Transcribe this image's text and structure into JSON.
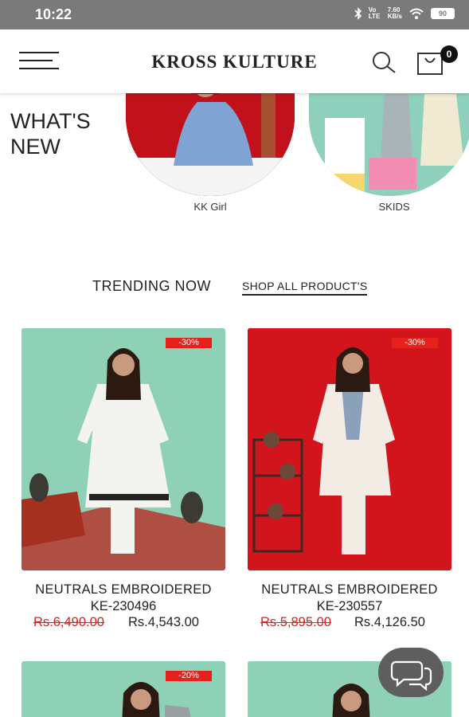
{
  "status_bar": {
    "time": "10:22",
    "network_label": "Vo LTE",
    "speed_value": "7.60",
    "speed_unit": "KB/s",
    "battery": "90"
  },
  "header": {
    "brand": "KROSS KULTURE",
    "cart_count": "0"
  },
  "whats_new": {
    "title": "WHAT'S NEW",
    "categories": [
      {
        "label": "KK Girl",
        "bg": "#c1121c"
      },
      {
        "label": "SKIDS",
        "bg": "#8ed0bb"
      }
    ]
  },
  "trending": {
    "title": "TRENDING NOW",
    "shop_all": "SHOP ALL PRODUCT'S"
  },
  "products": [
    {
      "name": "NEUTRALS EMBROIDERED",
      "code": "KE-230496",
      "old_price": "Rs.6,490.00",
      "new_price": "Rs.4,543.00",
      "discount": "-30%",
      "bg": "#8fd1b6"
    },
    {
      "name": "NEUTRALS EMBROIDERED",
      "code": "KE-230557",
      "old_price": "Rs.5,895.00",
      "new_price": "Rs.4,126.50",
      "discount": "-30%",
      "bg": "#d2141c"
    },
    {
      "discount": "-20%",
      "bg": "#8fd1b6"
    },
    {
      "bg": "#8fd1b6"
    }
  ],
  "colors": {
    "accent_red": "#e8201c",
    "price_red": "#e21b1b",
    "status_bar": "#7a7a7a",
    "chat_button": "#5e5e5e"
  }
}
